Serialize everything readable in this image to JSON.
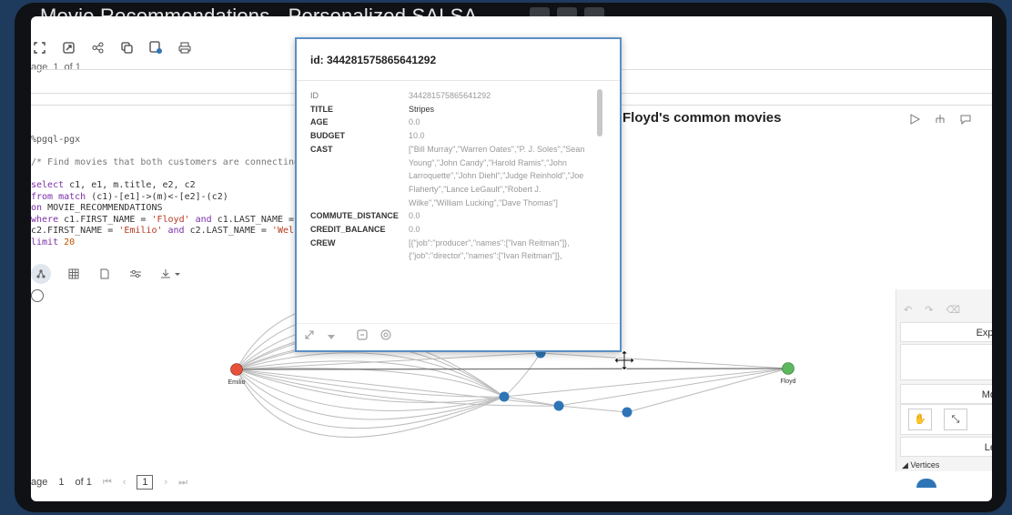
{
  "window": {
    "title": "Movie Recommendations - Personalized SALSA"
  },
  "toolbar": {
    "icons": [
      "expand-icon",
      "open-external-icon",
      "share-icon",
      "copy-icon",
      "save-icon",
      "print-icon"
    ]
  },
  "pager_top": {
    "label": "age",
    "page": "1",
    "of": "of 1"
  },
  "code": {
    "magic": "%pgql-pgx",
    "comment": "/* Find movies that both customers are connecting",
    "line1_kw": "select",
    "line1": " c1, e1, m.title, e2, c2",
    "line2_kw": "from match",
    "line2": " (c1)-[e1]->(m)<-[e2]-(c2)",
    "line3_kw": "on",
    "line3": " MOVIE_RECOMMENDATIONS",
    "line4_kw": "where",
    "line4a": " c1.FIRST_NAME = ",
    "line4_str": "'Floyd'",
    "line4_and": " and",
    "line4b": " c1.LAST_NAME =",
    "line5a": "c2.FIRST_NAME = ",
    "line5_str1": "'Emilio'",
    "line5_and": " and",
    "line5b": " c2.LAST_NAME = ",
    "line5_str2": "'Wel",
    "line6_kw": "limit",
    "line6_num": " 20"
  },
  "paragraph": {
    "title": "Floyd's common movies"
  },
  "popup": {
    "title": "id: 344281575865641292",
    "properties": [
      {
        "key": "id",
        "value": "344281575865641292",
        "bold": false
      },
      {
        "key": "TITLE",
        "value": "Stripes",
        "bold": true
      },
      {
        "key": "AGE",
        "value": "0.0",
        "bold": true
      },
      {
        "key": "BUDGET",
        "value": "10.0",
        "bold": true
      },
      {
        "key": "CAST",
        "value": "[\"Bill Murray\",\"Warren Oates\",\"P. J. Soles\",\"Sean Young\",\"John Candy\",\"Harold Ramis\",\"John Larroquette\",\"John Diehl\",\"Judge Reinhold\",\"Joe Flaherty\",\"Lance LeGault\",\"Robert J. Wilke\",\"William Lucking\",\"Dave Thomas\"]",
        "bold": true
      },
      {
        "key": "COMMUTE_DISTANCE",
        "value": "0.0",
        "bold": true
      },
      {
        "key": "CREDIT_BALANCE",
        "value": "0.0",
        "bold": true
      },
      {
        "key": "CREW",
        "value": "[{\"job\":\"producer\",\"names\":[\"Ivan Reitman\"]},{\"job\":\"director\",\"names\":[\"Ivan Reitman\"]},",
        "bold": true
      }
    ]
  },
  "graph": {
    "nodes": [
      {
        "label": "Emilio",
        "color": "#e8503a"
      },
      {
        "label": "Floyd",
        "color": "#5cb85c"
      }
    ],
    "movie_color": "#2e75b6"
  },
  "right_panel": {
    "explore": "Expl",
    "modes": "Mo",
    "legend": "Le",
    "vertices": "Vertices"
  },
  "pager_bottom": {
    "label": "age",
    "page_num": "1",
    "of": "of 1",
    "current": "1"
  }
}
